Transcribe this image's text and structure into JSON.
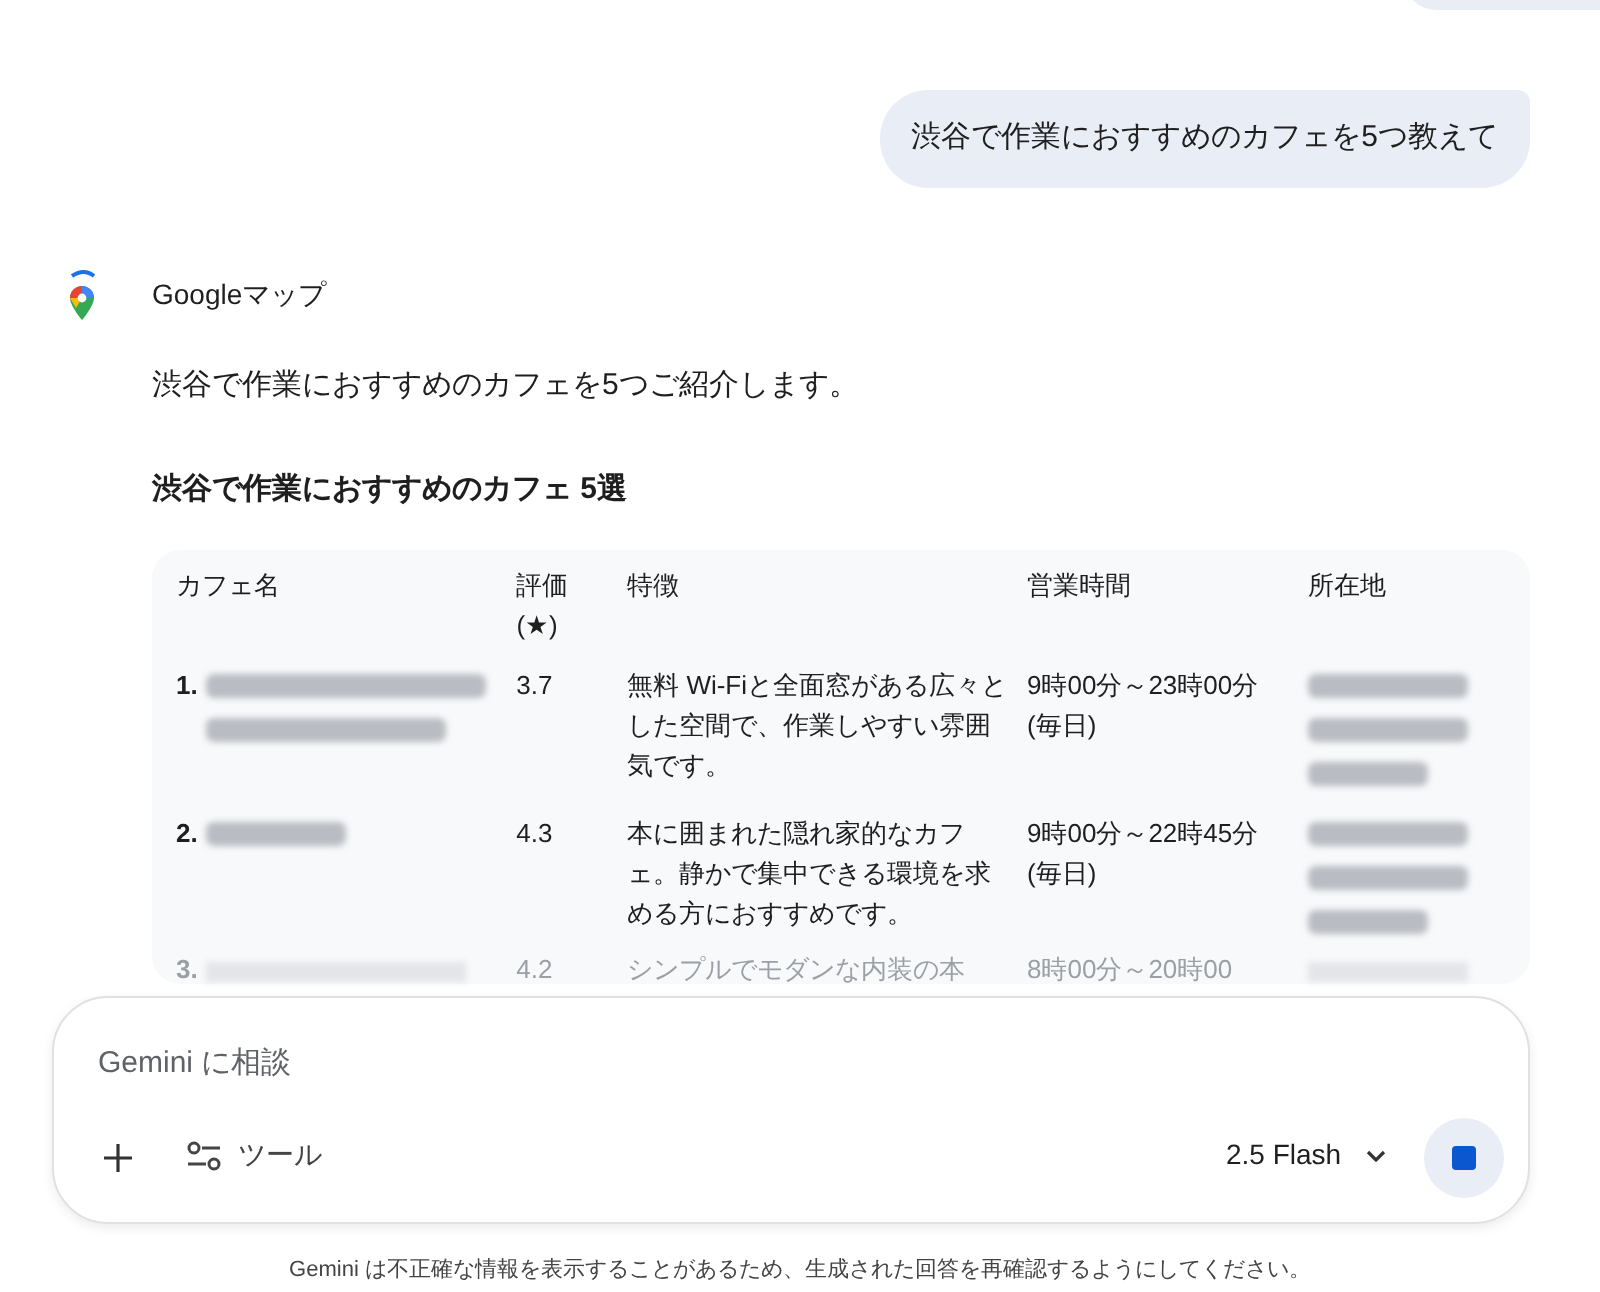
{
  "user_message": "渋谷で作業におすすめのカフェを5つ教えて",
  "response": {
    "source": "Googleマップ",
    "intro": "渋谷で作業におすすめのカフェを5つご紹介します。",
    "heading": "渋谷で作業におすすめのカフェ 5選",
    "table": {
      "columns": [
        "カフェ名",
        "評価\n(★)",
        "特徴",
        "営業時間",
        "所在地"
      ],
      "rows": [
        {
          "number": "1.",
          "rating": "3.7",
          "features": "無料 Wi-Fiと全面窓がある広々とした空間で、作業しやすい雰囲気です。",
          "hours": "9時00分～23時00分 (毎日)",
          "faded": false
        },
        {
          "number": "2.",
          "rating": "4.3",
          "features": "本に囲まれた隠れ家的なカフェ。静かで集中できる環境を求める方におすすめです。",
          "hours": "9時00分～22時45分 (毎日)",
          "faded": false
        },
        {
          "number": "3.",
          "rating": "4.2",
          "features": "シンプルでモダンな内装の本",
          "hours": "8時00分～20時00",
          "faded": true
        }
      ]
    }
  },
  "composer": {
    "placeholder": "Gemini に相談",
    "tools": "ツール",
    "model": "2.5 Flash"
  },
  "disclaimer": "Gemini は不正確な情報を表示することがあるため、生成された回答を再確認するようにしてください。"
}
